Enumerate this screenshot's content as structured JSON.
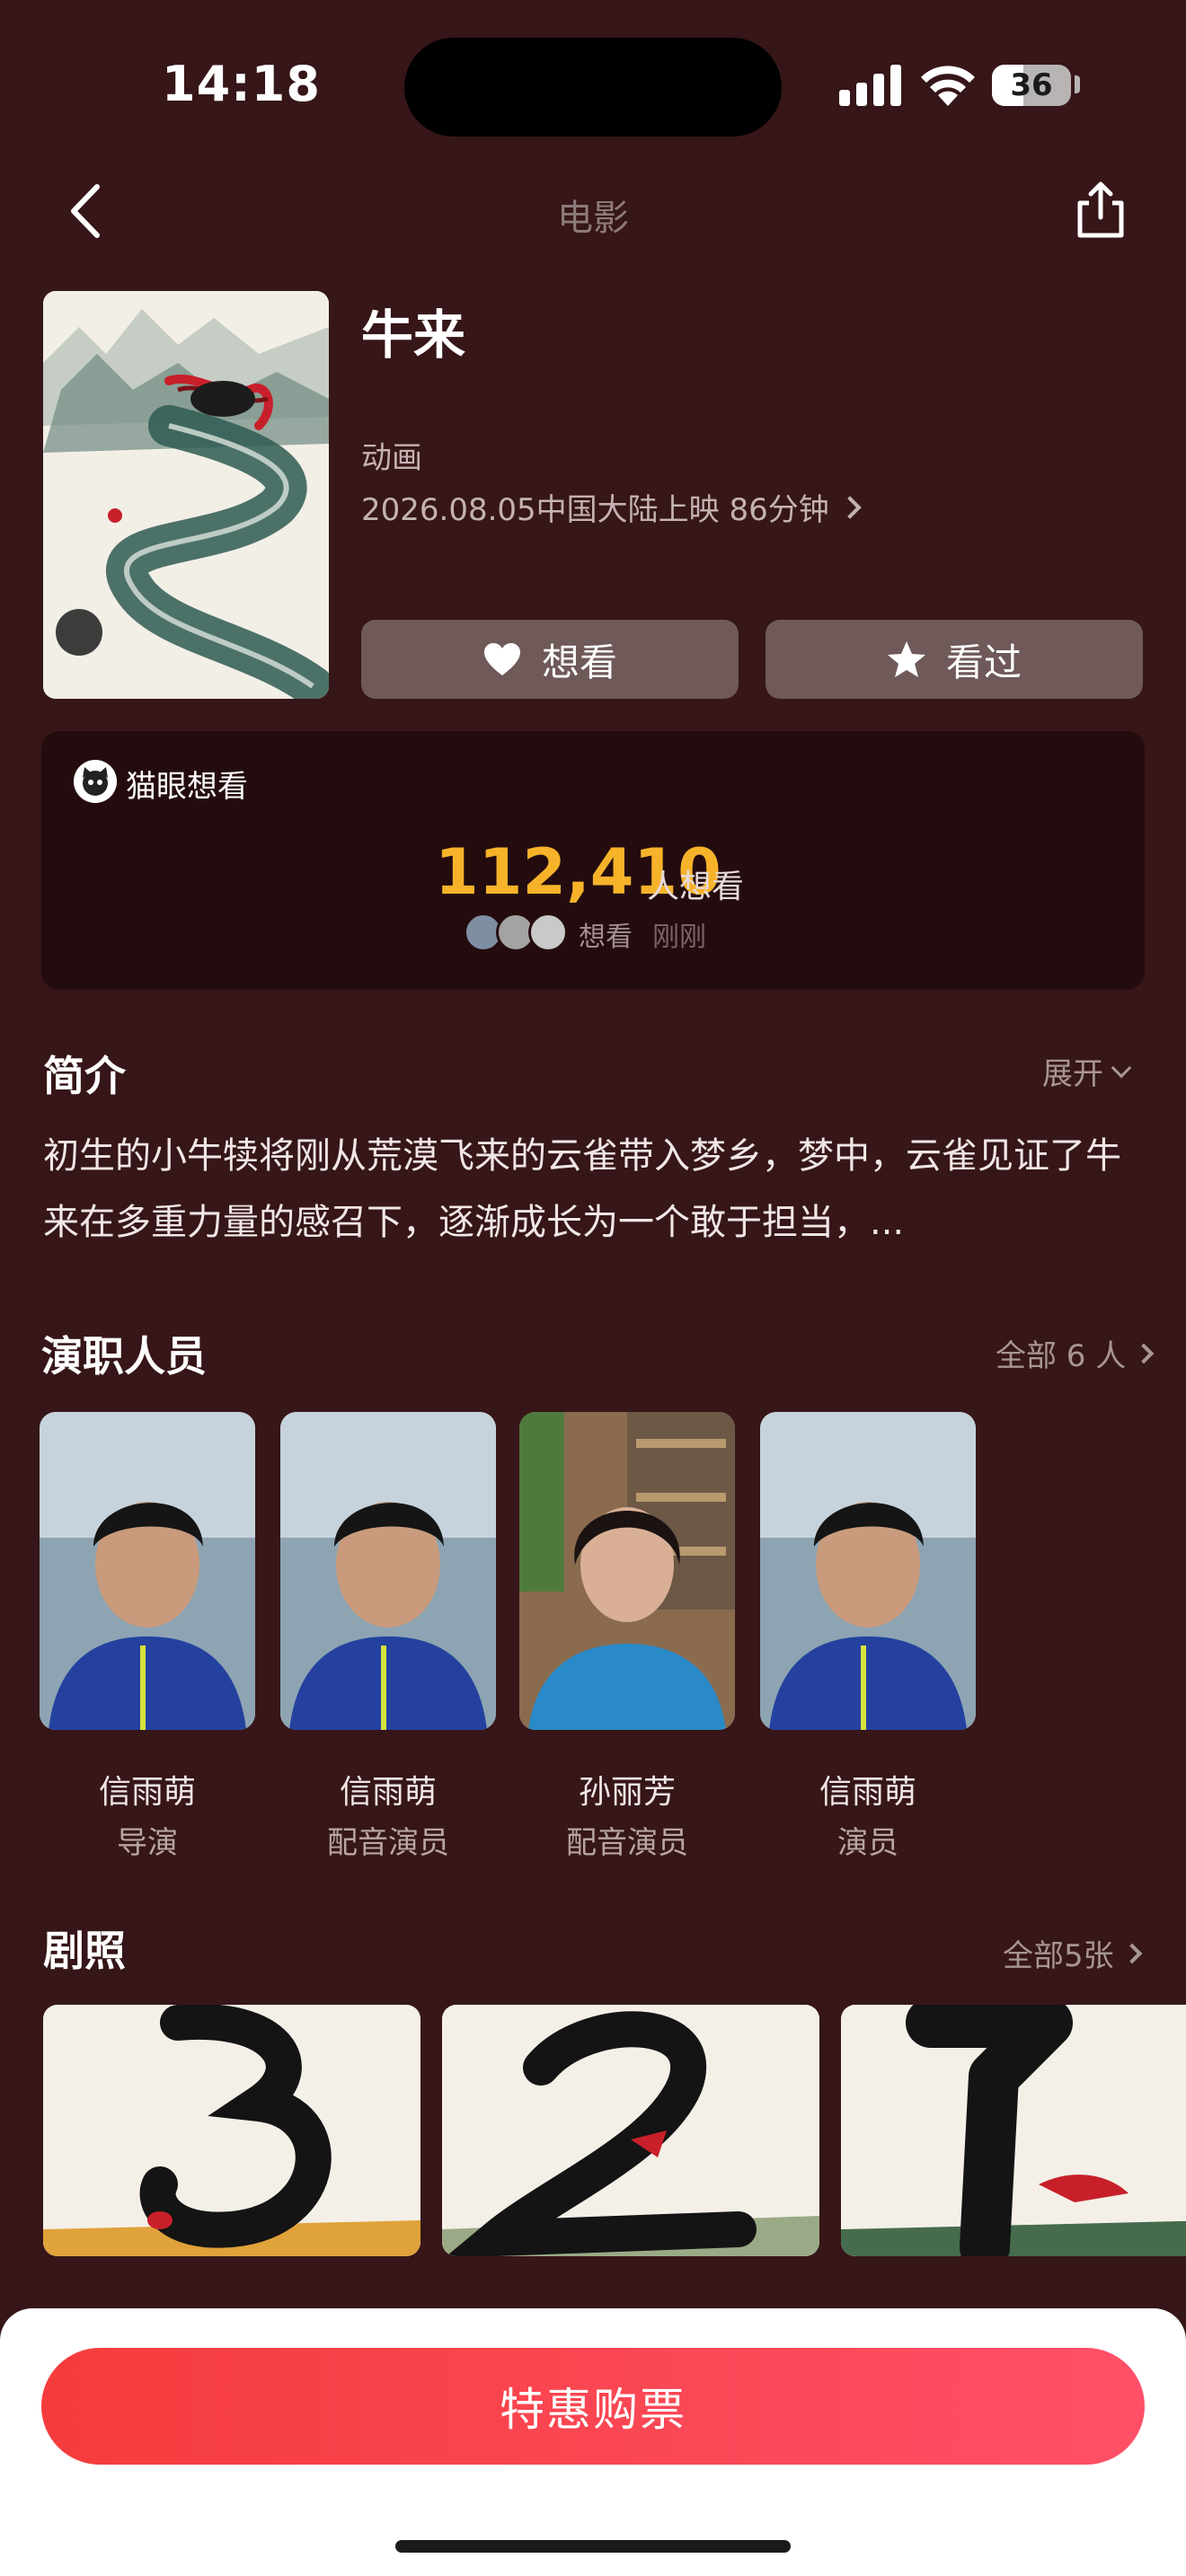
{
  "status_bar": {
    "time": "14:18",
    "battery": "36"
  },
  "nav": {
    "title": "电影"
  },
  "movie": {
    "title": "牛来",
    "genre": "动画",
    "release": "2026.08.05中国大陆上映 86分钟",
    "want_label": "想看",
    "seen_label": "看过"
  },
  "want_card": {
    "label": "猫眼想看",
    "count": "112,410",
    "unit": "人想看",
    "recent_text": "想看",
    "recent_time": "刚刚"
  },
  "synopsis": {
    "title": "简介",
    "expand": "展开",
    "text": "初生的小牛犊将刚从荒漠飞来的云雀带入梦乡，梦中，云雀见证了牛来在多重力量的感召下，逐渐成长为一个敢于担当，..."
  },
  "cast": {
    "title": "演职人员",
    "more": "全部 6 人",
    "members": [
      {
        "name": "信雨萌",
        "role": "导演"
      },
      {
        "name": "信雨萌",
        "role": "配音演员"
      },
      {
        "name": "孙丽芳",
        "role": "配音演员"
      },
      {
        "name": "信雨萌",
        "role": "演员"
      }
    ]
  },
  "stills": {
    "title": "剧照",
    "more": "全部5张"
  },
  "bottom": {
    "buy_label": "特惠购票"
  },
  "colors": {
    "background": "#361618",
    "accent_count": "#f6b32a",
    "buy_button": "#f53c3c"
  }
}
